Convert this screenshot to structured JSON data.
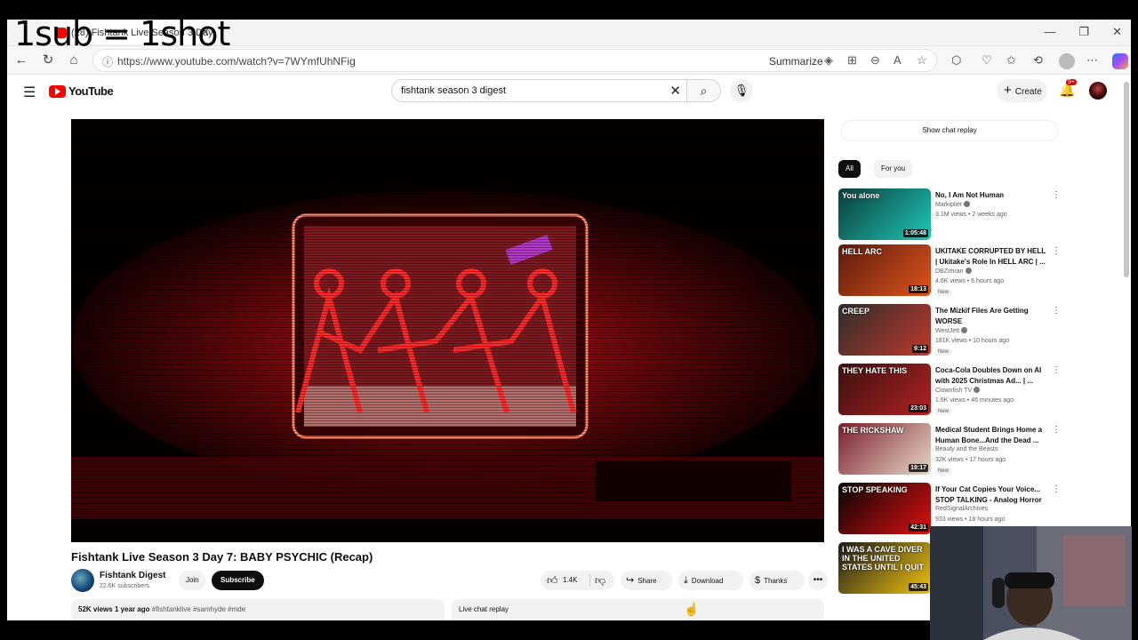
{
  "overlay": {
    "text": "1sub = 1shot"
  },
  "browser": {
    "tab_title": "(28) Fishtank Live Season 3 Day",
    "url": "https://www.youtube.com/watch?v=7WYmfUhNFig",
    "summarize_label": "Summarize"
  },
  "youtube": {
    "logo_text": "YouTube",
    "search_query": "fishtank season 3 digest",
    "create_label": "Create",
    "notification_badge": "9+"
  },
  "video": {
    "title": "Fishtank Live Season 3 Day 7: BABY PSYCHIC (Recap)",
    "channel": "Fishtank Digest",
    "subscribers": "22.6K subscribers",
    "join_label": "Join",
    "subscribe_label": "Subscribe",
    "likes": "1.4K",
    "share_label": "Share",
    "download_label": "Download",
    "thanks_label": "Thanks",
    "views": "52K views",
    "age": "1 year ago",
    "tags": "#fishtanklive #samhyde #mde",
    "live_chat_label": "Live chat replay"
  },
  "sidebar": {
    "chat_replay_label": "Show chat replay",
    "chips": [
      "All",
      "For you"
    ],
    "recommendations": [
      {
        "title": "No, I Am Not Human",
        "channel": "Markiplier",
        "verified": true,
        "meta": "3.1M views • 2 weeks ago",
        "duration": "1:05:48",
        "is_new": false,
        "thumb_text": "You alone",
        "colors": [
          "#0b3d3a",
          "#1fc7b5"
        ]
      },
      {
        "title": "UKITAKE CORRUPTED BY HELL | Ukitake's Role In HELL ARC | ...",
        "channel": "DBZimran",
        "verified": true,
        "meta": "4.6K views • 6 hours ago",
        "duration": "18:13",
        "is_new": true,
        "thumb_text": "HELL ARC",
        "colors": [
          "#5a1a0e",
          "#e0551c"
        ]
      },
      {
        "title": "The Mizkif Files Are Getting WORSE",
        "channel": "WestJett",
        "verified": true,
        "meta": "181K views • 10 hours ago",
        "duration": "9:12",
        "is_new": true,
        "thumb_text": "CREEP",
        "colors": [
          "#2d2d2d",
          "#c0392b"
        ]
      },
      {
        "title": "Coca-Cola Doubles Down on AI with 2025 Christmas Ad... | ...",
        "channel": "Clownfish TV",
        "verified": true,
        "meta": "1.6K views • 46 minutes ago",
        "duration": "23:03",
        "is_new": true,
        "thumb_text": "THEY HATE THIS",
        "colors": [
          "#3a1010",
          "#b22222"
        ]
      },
      {
        "title": "Medical Student Brings Home a Human Bone...And the Dead ...",
        "channel": "Beauty and the Beasts",
        "verified": false,
        "meta": "32K views • 17 hours ago",
        "duration": "19:17",
        "is_new": true,
        "thumb_text": "THE RICKSHAW",
        "colors": [
          "#7a1e2c",
          "#e8d8c8"
        ]
      },
      {
        "title": "If Your Cat Copies Your Voice... STOP TALKING - Analog Horror",
        "channel": "RedSignalArchives",
        "verified": false,
        "meta": "933 views • 18 hours ago",
        "duration": "42:31",
        "is_new": false,
        "thumb_text": "STOP SPEAKING",
        "colors": [
          "#050505",
          "#d11"
        ]
      },
      {
        "title": "",
        "channel": "",
        "verified": false,
        "meta": "",
        "duration": "45:43",
        "is_new": false,
        "thumb_text": "I WAS A CAVE DIVER IN THE UNITED STATES UNTIL I QUIT",
        "colors": [
          "#1a1a1a",
          "#f1c40f"
        ]
      }
    ]
  }
}
